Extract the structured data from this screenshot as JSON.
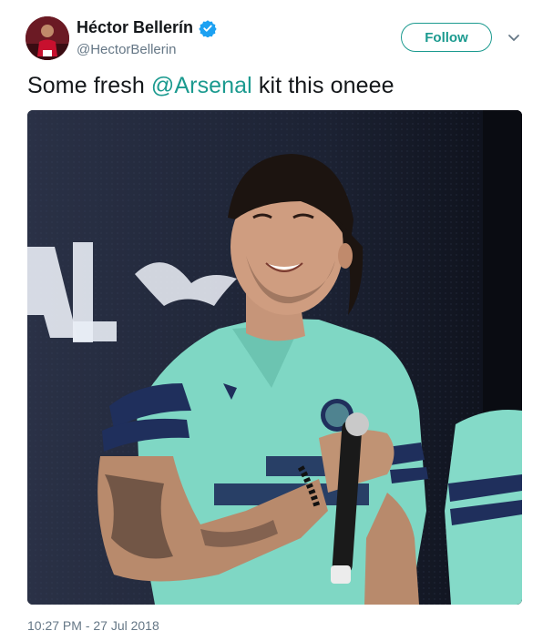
{
  "user": {
    "display_name": "Héctor Bellerín",
    "handle": "@HectorBellerin",
    "avatar_icon": "profile-avatar",
    "verified_icon": "verified-badge-icon"
  },
  "actions": {
    "follow_label": "Follow",
    "more_icon": "chevron-down-icon"
  },
  "tweet": {
    "text_before": "Some fresh ",
    "mention": "@Arsenal",
    "text_after": " kit this oneee",
    "image_description_icon": "photo-media",
    "timestamp": "10:27 PM - 27 Jul 2018"
  },
  "colors": {
    "accent": "#1b9a8f",
    "verified": "#1da1f2",
    "muted": "#657786",
    "text": "#14171a",
    "kit_teal": "#7fd7c4",
    "kit_navy": "#1f2f5c"
  }
}
